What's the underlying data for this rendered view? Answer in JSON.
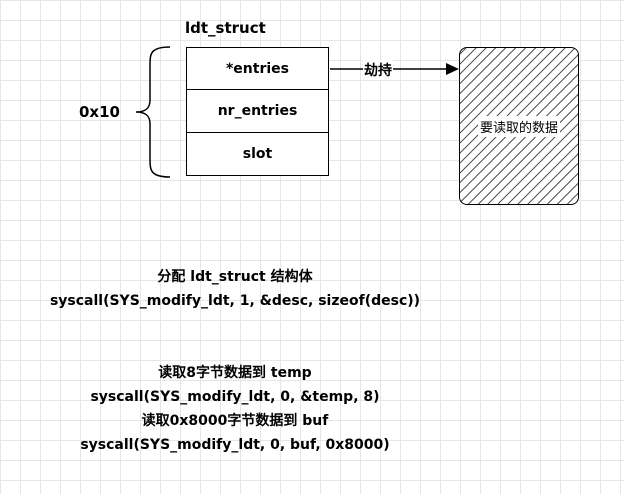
{
  "struct": {
    "name": "ldt_struct",
    "fields": [
      "*entries",
      "nr_entries",
      "slot"
    ]
  },
  "size_label": "0x10",
  "arrow_label": "劫持",
  "target_label": "要读取的数据",
  "captions": [
    {
      "lines": [
        "分配 ldt_struct 结构体",
        "syscall(SYS_modify_ldt, 1, &desc, sizeof(desc))"
      ]
    },
    {
      "lines": [
        "读取8字节数据到 temp",
        "syscall(SYS_modify_ldt, 0, &temp, 8)",
        "读取0x8000字节数据到 buf",
        "syscall(SYS_modify_ldt, 0, buf, 0x8000)"
      ]
    }
  ]
}
